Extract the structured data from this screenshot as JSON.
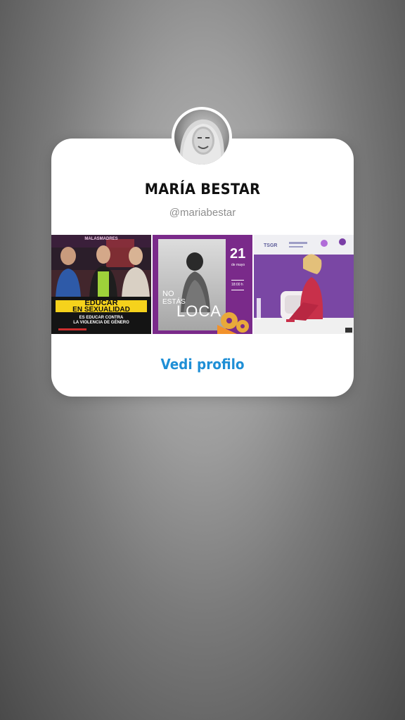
{
  "profile": {
    "name": "MARÍA BESTAR",
    "handle": "@mariabestar"
  },
  "posts": [
    {
      "header": "MALASMADRES",
      "headline_line1": "EDUCAR",
      "headline_line2": "EN SEXUALIDAD",
      "subline1": "ES EDUCAR CONTRA",
      "subline2": "LA VIOLENCIA DE GÉNERO"
    },
    {
      "title_line1": "NO",
      "title_line2": "ESTÁS",
      "title_line3": "LOCA",
      "date_number": "21",
      "date_label": "de mayo",
      "time": "18:00 h"
    },
    {
      "logo_text": "TSGR"
    }
  ],
  "actions": {
    "view_profile": "Vedi profilo"
  },
  "colors": {
    "accent": "#1f8fd6",
    "card": "#ffffff",
    "handle_gray": "#8e8e8e",
    "poster_purple": "#7a2a8a",
    "poster_yellow": "#f5d21c"
  }
}
